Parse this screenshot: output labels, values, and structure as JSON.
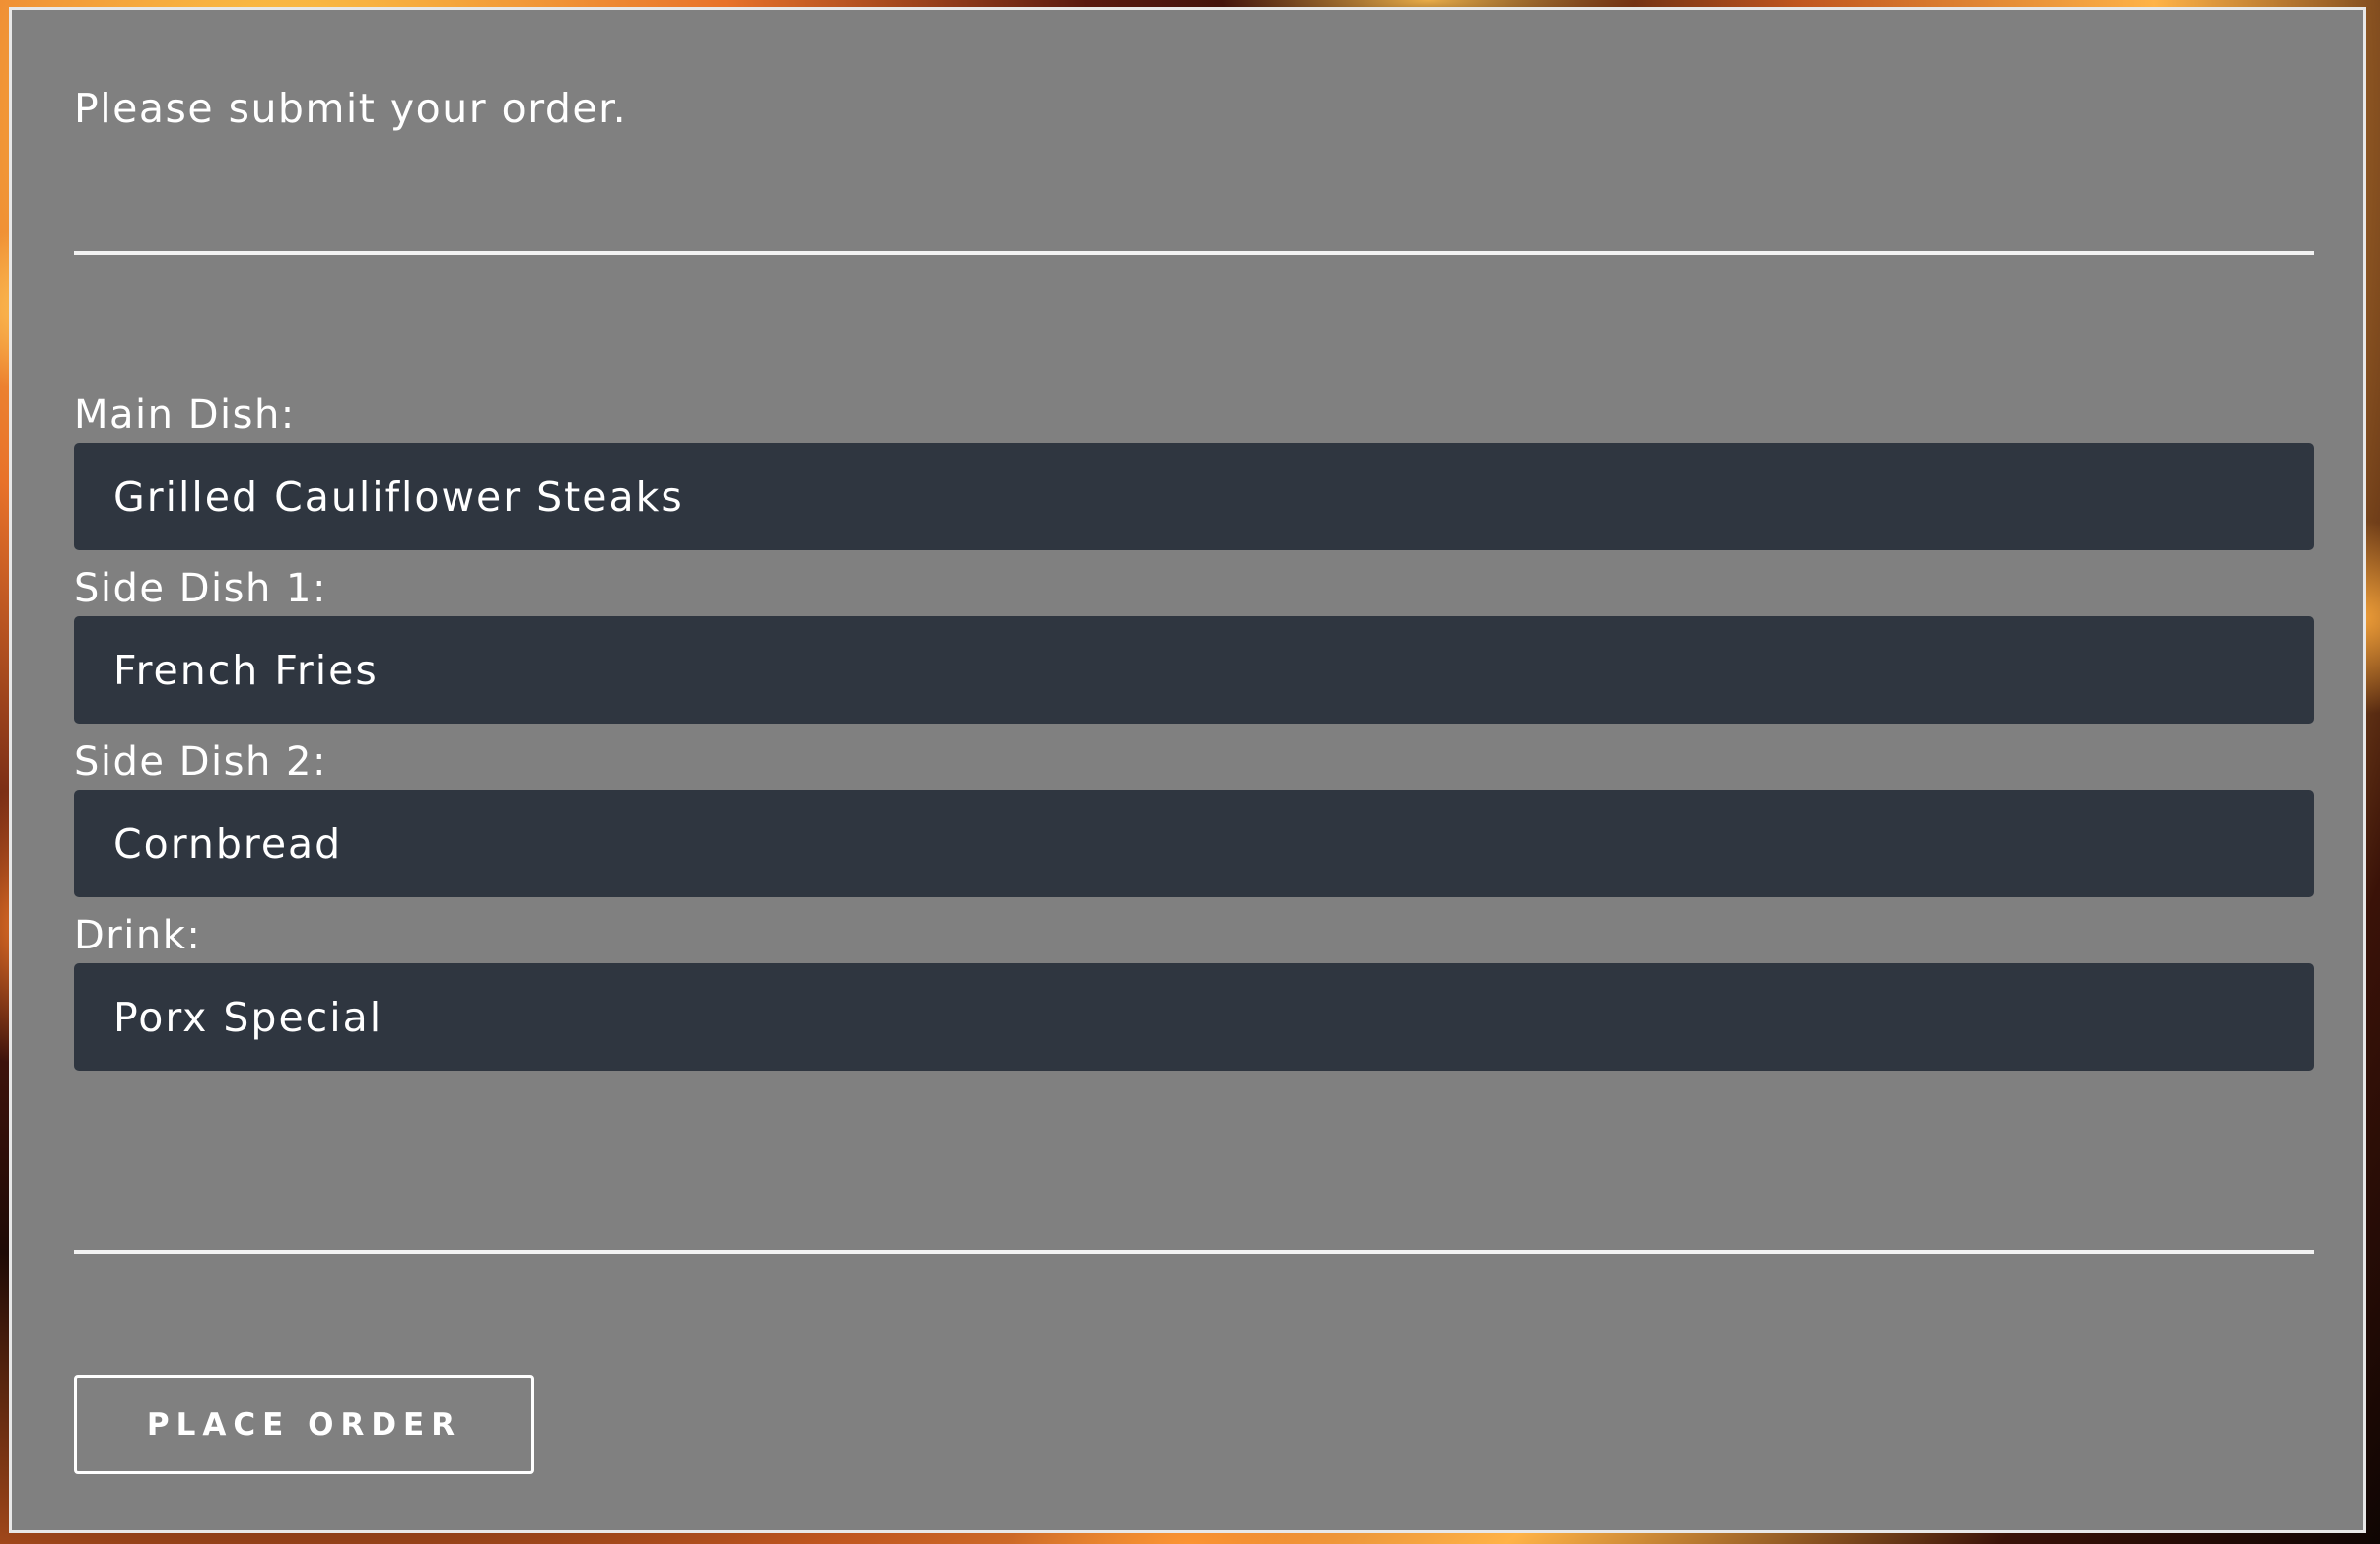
{
  "form": {
    "prompt": "Please submit your order.",
    "fields": [
      {
        "label": "Main Dish:",
        "value": "Grilled Cauliflower Steaks"
      },
      {
        "label": "Side Dish 1:",
        "value": "French Fries"
      },
      {
        "label": "Side Dish 2:",
        "value": "Cornbread"
      },
      {
        "label": "Drink:",
        "value": "Porx Special"
      }
    ],
    "submit_label": "PLACE ORDER"
  },
  "colors": {
    "panel": "#808080",
    "input_background": "#2f3640",
    "text": "#ffffff"
  }
}
